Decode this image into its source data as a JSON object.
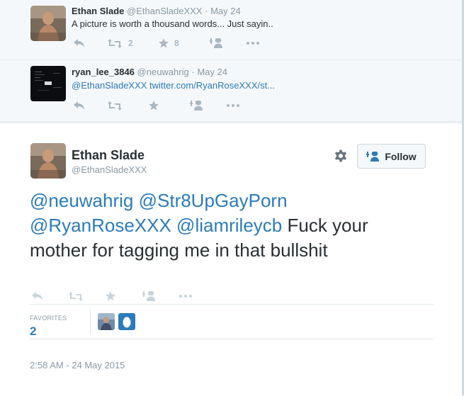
{
  "replies": [
    {
      "name": "Ethan Slade",
      "handle": "@EthanSladeXXX",
      "dot": "·",
      "date": "May 24",
      "text": "A picture is worth a thousand words... Just sayin..",
      "retweets": "2",
      "favorites": "8"
    },
    {
      "name": "ryan_lee_3846",
      "handle": "@neuwahrig",
      "dot": "·",
      "date": "May 24",
      "text": "@EthanSladeXXX twitter.com/RyanRoseXXX/st...",
      "retweets": "",
      "favorites": ""
    }
  ],
  "main": {
    "name": "Ethan Slade",
    "handle": "@EthanSladeXXX",
    "follow_label": "Follow",
    "mentions": [
      "@neuwahrig",
      "@Str8UpGayPorn",
      "@RyanRoseXXX",
      "@liamrileycb"
    ],
    "text": "Fuck your mother for tagging me in that bullshit",
    "favorites_label": "FAVORITES",
    "favorites_count": "2",
    "timestamp": "2:58 AM - 24 May 2015"
  },
  "icons": {
    "reply": "reply-icon",
    "retweet": "retweet-icon",
    "favorite": "star-icon",
    "follow": "follow-icon",
    "more": "more-icon",
    "gear": "gear-icon"
  },
  "colors": {
    "link": "#2b7bb9",
    "icon": "#aab8c2",
    "muted": "#8899a6"
  }
}
